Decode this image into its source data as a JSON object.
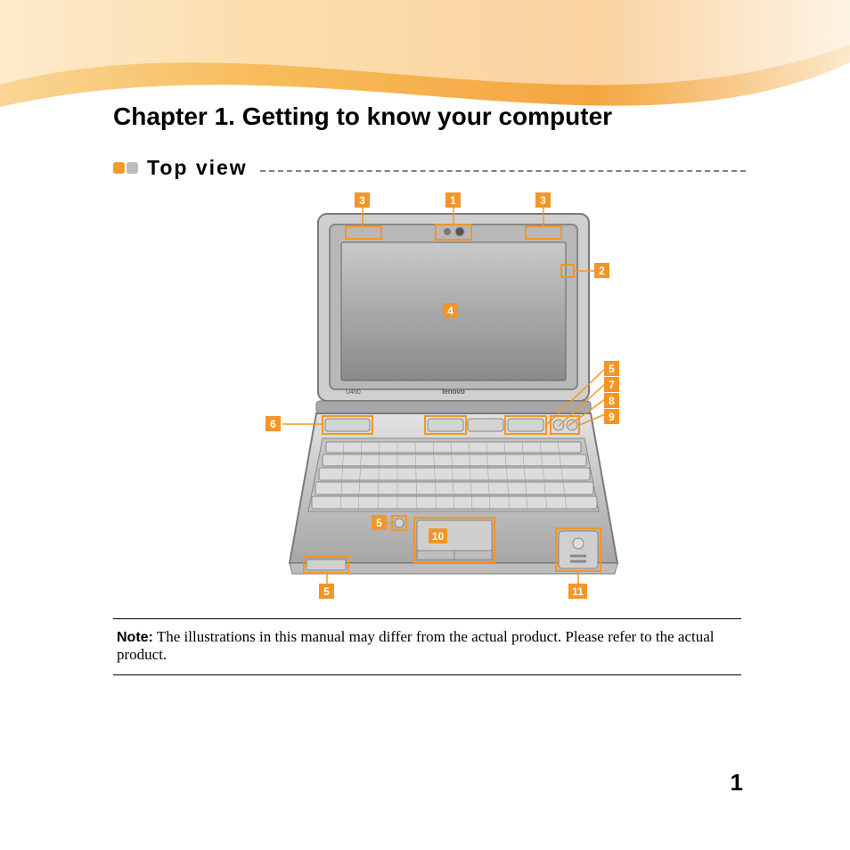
{
  "chapter": {
    "title": "Chapter 1. Getting to know your computer"
  },
  "section": {
    "title": "Top view"
  },
  "note": {
    "label": "Note:",
    "text": "The illustrations in this manual may differ from the actual product. Please refer to the actual product."
  },
  "page_number": "1",
  "callouts": {
    "c1": "1",
    "c2": "2",
    "c3a": "3",
    "c3b": "3",
    "c4": "4",
    "c5a": "5",
    "c5b": "5",
    "c5c": "5",
    "c6": "6",
    "c7": "7",
    "c8": "8",
    "c9": "9",
    "c10": "10",
    "c11": "11"
  },
  "diagram": {
    "brand": "lenovo",
    "model": "U460"
  }
}
